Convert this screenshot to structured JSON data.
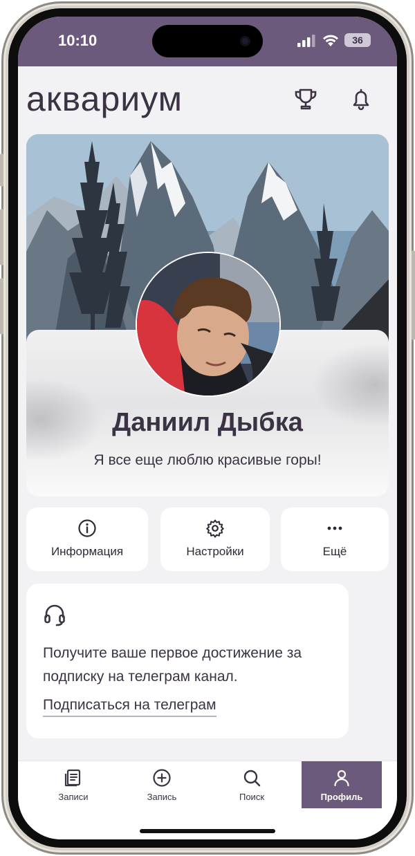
{
  "status_bar": {
    "time": "10:10",
    "battery": "36",
    "icons": [
      "cellular-signal-icon",
      "wifi-icon",
      "battery-icon"
    ]
  },
  "header": {
    "logo": "аквариум",
    "icons": [
      "trophy-icon",
      "bell-icon"
    ]
  },
  "profile": {
    "name": "Даниил Дыбка",
    "bio": "Я все еще люблю красивые горы!"
  },
  "actions": [
    {
      "label": "Информация",
      "icon": "info-icon"
    },
    {
      "label": "Настройки",
      "icon": "gear-icon"
    },
    {
      "label": "Ещё",
      "icon": "more-dots-icon"
    }
  ],
  "promo": {
    "icon": "headset-icon",
    "text": "Получите ваше первое достижение за подписку на телеграм канал.",
    "link": "Подписаться на телеграм"
  },
  "tabbar": {
    "tabs": [
      {
        "label": "Записи",
        "icon": "notes-icon",
        "active": false
      },
      {
        "label": "Запись",
        "icon": "plus-circle-icon",
        "active": false
      },
      {
        "label": "Поиск",
        "icon": "search-icon",
        "active": false
      },
      {
        "label": "Профиль",
        "icon": "user-icon",
        "active": true
      }
    ]
  },
  "colors": {
    "accent": "#6b5a7b",
    "text": "#3b3343",
    "background": "#f2f1f3",
    "card": "#ffffff"
  }
}
